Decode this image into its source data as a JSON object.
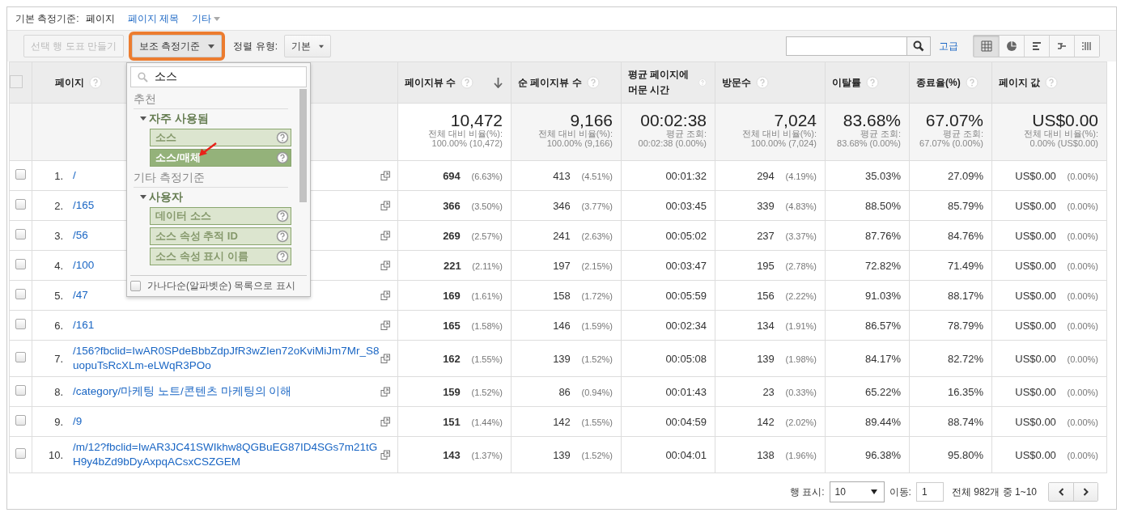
{
  "dimension_bar": {
    "label": "기본 측정기준:",
    "options": [
      {
        "label": "페이지",
        "selected": true,
        "caret": false
      },
      {
        "label": "페이지 제목",
        "selected": false,
        "caret": false
      },
      {
        "label": "기타",
        "selected": false,
        "caret": true
      }
    ]
  },
  "toolbar": {
    "chart_button": {
      "label": "선택 행 도표 만들기",
      "disabled": true
    },
    "secondary_dimension": {
      "label": "보조 측정기준",
      "highlighted": true
    },
    "sort_label": "정렬 유형:",
    "sort_value": "기본",
    "advanced_link": "고급",
    "views": [
      {
        "kind": "table",
        "selected": true
      },
      {
        "kind": "pie",
        "selected": false
      },
      {
        "kind": "bar",
        "selected": false
      },
      {
        "kind": "compare",
        "selected": false
      },
      {
        "kind": "pivot",
        "selected": false
      }
    ]
  },
  "dimension_menu": {
    "search_value": "소스",
    "sections": [
      {
        "title": "추천",
        "groups": [
          {
            "title": "자주 사용됨",
            "expanded": true,
            "items": [
              {
                "label": "소스",
                "selected": false
              },
              {
                "label": "소스/매체",
                "selected": true
              }
            ]
          }
        ]
      },
      {
        "title": "기타 측정기준",
        "groups": [
          {
            "title": "사용자",
            "expanded": true,
            "items": [
              {
                "label": "데이터 소스",
                "selected": false
              },
              {
                "label": "소스 속성 추적 ID",
                "selected": false
              },
              {
                "label": "소스 속성 표시 이름",
                "selected": false
              }
            ]
          }
        ]
      }
    ],
    "alphabetical": {
      "label": "가나다순(알파벳순) 목록으로 표시",
      "checked": false
    }
  },
  "table": {
    "select_all_checked": false,
    "page_column": "페이지",
    "columns": [
      {
        "label": "페이지뷰 수",
        "sorted": true
      },
      {
        "label": "순 페이지뷰 수",
        "sorted": false
      },
      {
        "label": "평균 페이지에 머문 시간",
        "sorted": false
      },
      {
        "label": "방문수",
        "sorted": false
      },
      {
        "label": "이탈률",
        "sorted": false
      },
      {
        "label": "종료율(%)",
        "sorted": false
      },
      {
        "label": "페이지 값",
        "sorted": false
      }
    ],
    "totals": [
      {
        "value": "10,472",
        "caption": "전체 대비 비율(%):",
        "detail": "100.00% (10,472)"
      },
      {
        "value": "9,166",
        "caption": "전체 대비 비율(%):",
        "detail": "100.00% (9,166)"
      },
      {
        "value": "00:02:38",
        "caption": "평균 조회:",
        "detail": "00:02:38 (0.00%)"
      },
      {
        "value": "7,024",
        "caption": "전체 대비 비율(%):",
        "detail": "100.00% (7,024)"
      },
      {
        "value": "83.68%",
        "caption": "평균 조회:",
        "detail": "83.68% (0.00%)"
      },
      {
        "value": "67.07%",
        "caption": "평균 조회:",
        "detail": "67.07% (0.00%)"
      },
      {
        "value": "US$0.00",
        "caption": "전체 대비 비율(%):",
        "detail": "0.00% (US$0.00)"
      }
    ],
    "rows": [
      {
        "checked": false,
        "number": "1.",
        "page": "/",
        "cells": [
          {
            "value": "694",
            "share": "(6.63%)"
          },
          {
            "value": "413",
            "share": "(4.51%)"
          },
          {
            "value": "00:01:32"
          },
          {
            "value": "294",
            "share": "(4.19%)"
          },
          {
            "value": "35.03%"
          },
          {
            "value": "27.09%"
          },
          {
            "value": "US$0.00",
            "share": "(0.00%)"
          }
        ]
      },
      {
        "checked": false,
        "number": "2.",
        "page": "/165",
        "cells": [
          {
            "value": "366",
            "share": "(3.50%)"
          },
          {
            "value": "346",
            "share": "(3.77%)"
          },
          {
            "value": "00:03:45"
          },
          {
            "value": "339",
            "share": "(4.83%)"
          },
          {
            "value": "88.50%"
          },
          {
            "value": "85.79%"
          },
          {
            "value": "US$0.00",
            "share": "(0.00%)"
          }
        ]
      },
      {
        "checked": false,
        "number": "3.",
        "page": "/56",
        "cells": [
          {
            "value": "269",
            "share": "(2.57%)"
          },
          {
            "value": "241",
            "share": "(2.63%)"
          },
          {
            "value": "00:05:02"
          },
          {
            "value": "237",
            "share": "(3.37%)"
          },
          {
            "value": "87.76%"
          },
          {
            "value": "84.76%"
          },
          {
            "value": "US$0.00",
            "share": "(0.00%)"
          }
        ]
      },
      {
        "checked": false,
        "number": "4.",
        "page": "/100",
        "cells": [
          {
            "value": "221",
            "share": "(2.11%)"
          },
          {
            "value": "197",
            "share": "(2.15%)"
          },
          {
            "value": "00:03:47"
          },
          {
            "value": "195",
            "share": "(2.78%)"
          },
          {
            "value": "72.82%"
          },
          {
            "value": "71.49%"
          },
          {
            "value": "US$0.00",
            "share": "(0.00%)"
          }
        ]
      },
      {
        "checked": false,
        "number": "5.",
        "page": "/47",
        "cells": [
          {
            "value": "169",
            "share": "(1.61%)"
          },
          {
            "value": "158",
            "share": "(1.72%)"
          },
          {
            "value": "00:05:59"
          },
          {
            "value": "156",
            "share": "(2.22%)"
          },
          {
            "value": "91.03%"
          },
          {
            "value": "88.17%"
          },
          {
            "value": "US$0.00",
            "share": "(0.00%)"
          }
        ]
      },
      {
        "checked": false,
        "number": "6.",
        "page": "/161",
        "cells": [
          {
            "value": "165",
            "share": "(1.58%)"
          },
          {
            "value": "146",
            "share": "(1.59%)"
          },
          {
            "value": "00:02:34"
          },
          {
            "value": "134",
            "share": "(1.91%)"
          },
          {
            "value": "86.57%"
          },
          {
            "value": "78.79%"
          },
          {
            "value": "US$0.00",
            "share": "(0.00%)"
          }
        ]
      },
      {
        "checked": false,
        "number": "7.",
        "page": "/156?fbclid=IwAR0SPdeBbbZdpJfR3wZIen72oKviMiJm7Mr_S8uopuTsRcXLm-eLWqR3POo",
        "cells": [
          {
            "value": "162",
            "share": "(1.55%)"
          },
          {
            "value": "139",
            "share": "(1.52%)"
          },
          {
            "value": "00:05:08"
          },
          {
            "value": "139",
            "share": "(1.98%)"
          },
          {
            "value": "84.17%"
          },
          {
            "value": "82.72%"
          },
          {
            "value": "US$0.00",
            "share": "(0.00%)"
          }
        ]
      },
      {
        "checked": false,
        "number": "8.",
        "page": "/category/마케팅 노트/콘텐츠 마케팅의 이해",
        "cells": [
          {
            "value": "159",
            "share": "(1.52%)"
          },
          {
            "value": "86",
            "share": "(0.94%)"
          },
          {
            "value": "00:01:43"
          },
          {
            "value": "23",
            "share": "(0.33%)"
          },
          {
            "value": "65.22%"
          },
          {
            "value": "16.35%"
          },
          {
            "value": "US$0.00",
            "share": "(0.00%)"
          }
        ]
      },
      {
        "checked": false,
        "number": "9.",
        "page": "/9",
        "cells": [
          {
            "value": "151",
            "share": "(1.44%)"
          },
          {
            "value": "142",
            "share": "(1.55%)"
          },
          {
            "value": "00:04:59"
          },
          {
            "value": "142",
            "share": "(2.02%)"
          },
          {
            "value": "89.44%"
          },
          {
            "value": "88.74%"
          },
          {
            "value": "US$0.00",
            "share": "(0.00%)"
          }
        ]
      },
      {
        "checked": false,
        "number": "10.",
        "page": "/m/12?fbclid=IwAR3JC41SWIkhw8QGBuEG87ID4SGs7m21tGH9y4bZd9bDyAxpqACsxCSZGEM",
        "cells": [
          {
            "value": "143",
            "share": "(1.37%)"
          },
          {
            "value": "139",
            "share": "(1.52%)"
          },
          {
            "value": "00:04:01"
          },
          {
            "value": "138",
            "share": "(1.96%)"
          },
          {
            "value": "96.38%"
          },
          {
            "value": "95.80%"
          },
          {
            "value": "US$0.00",
            "share": "(0.00%)"
          }
        ]
      }
    ]
  },
  "pagination": {
    "rows_label": "행 표시:",
    "rows_value": "10",
    "goto_label": "이동:",
    "goto_value": "1",
    "range": "전체 982개 중 1~10"
  }
}
